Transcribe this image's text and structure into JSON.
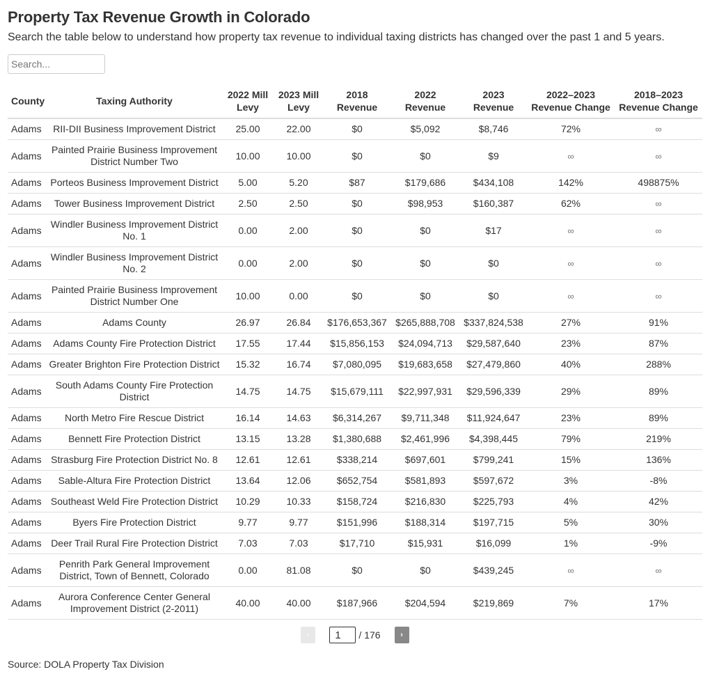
{
  "header": {
    "title": "Property Tax Revenue Growth in Colorado",
    "subtitle": "Search the table below to understand how property tax revenue to individual taxing districts has changed over the past 1 and 5 years."
  },
  "search": {
    "placeholder": "Search...",
    "value": ""
  },
  "chart_data": {
    "type": "table",
    "title": "Property Tax Revenue Growth in Colorado",
    "columns": [
      "County",
      "Taxing Authority",
      "2022 Mill Levy",
      "2023 Mill Levy",
      "2018 Revenue",
      "2022 Revenue",
      "2023 Revenue",
      "2022–2023 Revenue Change",
      "2018–2023 Revenue Change"
    ],
    "rows": [
      [
        "Adams",
        "RII-DII Business Improvement District",
        "25.00",
        "22.00",
        "$0",
        "$5,092",
        "$8,746",
        "72%",
        "∞"
      ],
      [
        "Adams",
        "Painted Prairie Business Improvement District Number Two",
        "10.00",
        "10.00",
        "$0",
        "$0",
        "$9",
        "∞",
        "∞"
      ],
      [
        "Adams",
        "Porteos Business Improvement District",
        "5.00",
        "5.20",
        "$87",
        "$179,686",
        "$434,108",
        "142%",
        "498875%"
      ],
      [
        "Adams",
        "Tower Business Improvement District",
        "2.50",
        "2.50",
        "$0",
        "$98,953",
        "$160,387",
        "62%",
        "∞"
      ],
      [
        "Adams",
        "Windler Business Improvement District No. 1",
        "0.00",
        "2.00",
        "$0",
        "$0",
        "$17",
        "∞",
        "∞"
      ],
      [
        "Adams",
        "Windler Business Improvement District No. 2",
        "0.00",
        "2.00",
        "$0",
        "$0",
        "$0",
        "∞",
        "∞"
      ],
      [
        "Adams",
        "Painted Prairie Business Improvement District Number One",
        "10.00",
        "0.00",
        "$0",
        "$0",
        "$0",
        "∞",
        "∞"
      ],
      [
        "Adams",
        "Adams County",
        "26.97",
        "26.84",
        "$176,653,367",
        "$265,888,708",
        "$337,824,538",
        "27%",
        "91%"
      ],
      [
        "Adams",
        "Adams County Fire Protection District",
        "17.55",
        "17.44",
        "$15,856,153",
        "$24,094,713",
        "$29,587,640",
        "23%",
        "87%"
      ],
      [
        "Adams",
        "Greater Brighton Fire Protection District",
        "15.32",
        "16.74",
        "$7,080,095",
        "$19,683,658",
        "$27,479,860",
        "40%",
        "288%"
      ],
      [
        "Adams",
        "South Adams County Fire Protection District",
        "14.75",
        "14.75",
        "$15,679,111",
        "$22,997,931",
        "$29,596,339",
        "29%",
        "89%"
      ],
      [
        "Adams",
        "North Metro Fire Rescue District",
        "16.14",
        "14.63",
        "$6,314,267",
        "$9,711,348",
        "$11,924,647",
        "23%",
        "89%"
      ],
      [
        "Adams",
        "Bennett Fire Protection District",
        "13.15",
        "13.28",
        "$1,380,688",
        "$2,461,996",
        "$4,398,445",
        "79%",
        "219%"
      ],
      [
        "Adams",
        "Strasburg Fire Protection District No. 8",
        "12.61",
        "12.61",
        "$338,214",
        "$697,601",
        "$799,241",
        "15%",
        "136%"
      ],
      [
        "Adams",
        "Sable-Altura Fire Protection District",
        "13.64",
        "12.06",
        "$652,754",
        "$581,893",
        "$597,672",
        "3%",
        "-8%"
      ],
      [
        "Adams",
        "Southeast Weld Fire Protection District",
        "10.29",
        "10.33",
        "$158,724",
        "$216,830",
        "$225,793",
        "4%",
        "42%"
      ],
      [
        "Adams",
        "Byers Fire Protection District",
        "9.77",
        "9.77",
        "$151,996",
        "$188,314",
        "$197,715",
        "5%",
        "30%"
      ],
      [
        "Adams",
        "Deer Trail Rural Fire Protection District",
        "7.03",
        "7.03",
        "$17,710",
        "$15,931",
        "$16,099",
        "1%",
        "-9%"
      ],
      [
        "Adams",
        "Penrith Park General Improvement District, Town of Bennett, Colorado",
        "0.00",
        "81.08",
        "$0",
        "$0",
        "$439,245",
        "∞",
        "∞"
      ],
      [
        "Adams",
        "Aurora Conference Center General Improvement District (2-2011)",
        "40.00",
        "40.00",
        "$187,966",
        "$204,594",
        "$219,869",
        "7%",
        "17%"
      ]
    ]
  },
  "table": {
    "headers": [
      {
        "line1": "County",
        "line2": ""
      },
      {
        "line1": "Taxing Authority",
        "line2": ""
      },
      {
        "line1": "2022 Mill",
        "line2": "Levy"
      },
      {
        "line1": "2023 Mill",
        "line2": "Levy"
      },
      {
        "line1": "2018",
        "line2": "Revenue"
      },
      {
        "line1": "2022",
        "line2": "Revenue"
      },
      {
        "line1": "2023",
        "line2": "Revenue"
      },
      {
        "line1": "2022–2023",
        "line2": "Revenue Change"
      },
      {
        "line1": "2018–2023",
        "line2": "Revenue Change"
      }
    ]
  },
  "pagination": {
    "prev_icon": "‹",
    "next_icon": "›",
    "current_page": "1",
    "total_label": "/ 176"
  },
  "footer": {
    "source": "Source: DOLA Property Tax Division"
  }
}
